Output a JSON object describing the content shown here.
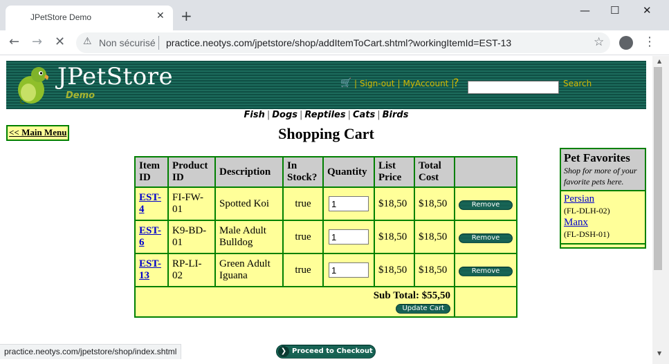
{
  "browser": {
    "tab_title": "JPetStore Demo",
    "tab_close": "✕",
    "new_tab": "+",
    "security_label": "Non sécurisé",
    "url": "practice.neotys.com/jpetstore/shop/addItemToCart.shtml?workingItemId=EST-13",
    "status_url": "practice.neotys.com/jpetstore/shop/index.shtml",
    "icons": [
      "back-arrow-icon",
      "forward-arrow-icon",
      "reload-stop-icon",
      "warning-icon",
      "star-icon",
      "profile-icon",
      "more-menu-icon"
    ]
  },
  "header": {
    "logo_text": "JPetStore",
    "logo_sub": "Demo",
    "sign_out": "Sign-out",
    "my_account": "MyAccount",
    "search_label": "Search",
    "search_value": ""
  },
  "quicklinks": [
    "Fish",
    "Dogs",
    "Reptiles",
    "Cats",
    "Birds"
  ],
  "main_menu_label": "<< Main Menu",
  "page_title": "Shopping Cart",
  "cart": {
    "headers": [
      "Item ID",
      "Product ID",
      "Description",
      "In Stock?",
      "Quantity",
      "List Price",
      "Total Cost"
    ],
    "rows": [
      {
        "item_id": "EST-4",
        "product_id": "FI-FW-01",
        "description": "Spotted Koi",
        "in_stock": "true",
        "quantity": "1",
        "list_price": "$18,50",
        "total_cost": "$18,50",
        "remove": "Remove"
      },
      {
        "item_id": "EST-6",
        "product_id": "K9-BD-01",
        "description": "Male Adult Bulldog",
        "in_stock": "true",
        "quantity": "1",
        "list_price": "$18,50",
        "total_cost": "$18,50",
        "remove": "Remove"
      },
      {
        "item_id": "EST-13",
        "product_id": "RP-LI-02",
        "description": "Green Adult Iguana",
        "in_stock": "true",
        "quantity": "1",
        "list_price": "$18,50",
        "total_cost": "$18,50",
        "remove": "Remove"
      }
    ],
    "subtotal": "Sub Total: $55,50",
    "update_cart": "Update Cart"
  },
  "favorites": {
    "title": "Pet Favorites",
    "subtitle": "Shop for more of your favorite pets here.",
    "items": [
      {
        "name": "Persian",
        "code": "(FL-DLH-02)"
      },
      {
        "name": "Manx",
        "code": "(FL-DSH-01)"
      }
    ]
  },
  "checkout_label": "Proceed to Checkout",
  "colors": {
    "banner_dark": "#0f4f44",
    "banner_link": "#d4b800",
    "table_border": "#008000",
    "table_bg": "#ffff99",
    "header_bg": "#cccccc",
    "link": "#0000cc"
  }
}
